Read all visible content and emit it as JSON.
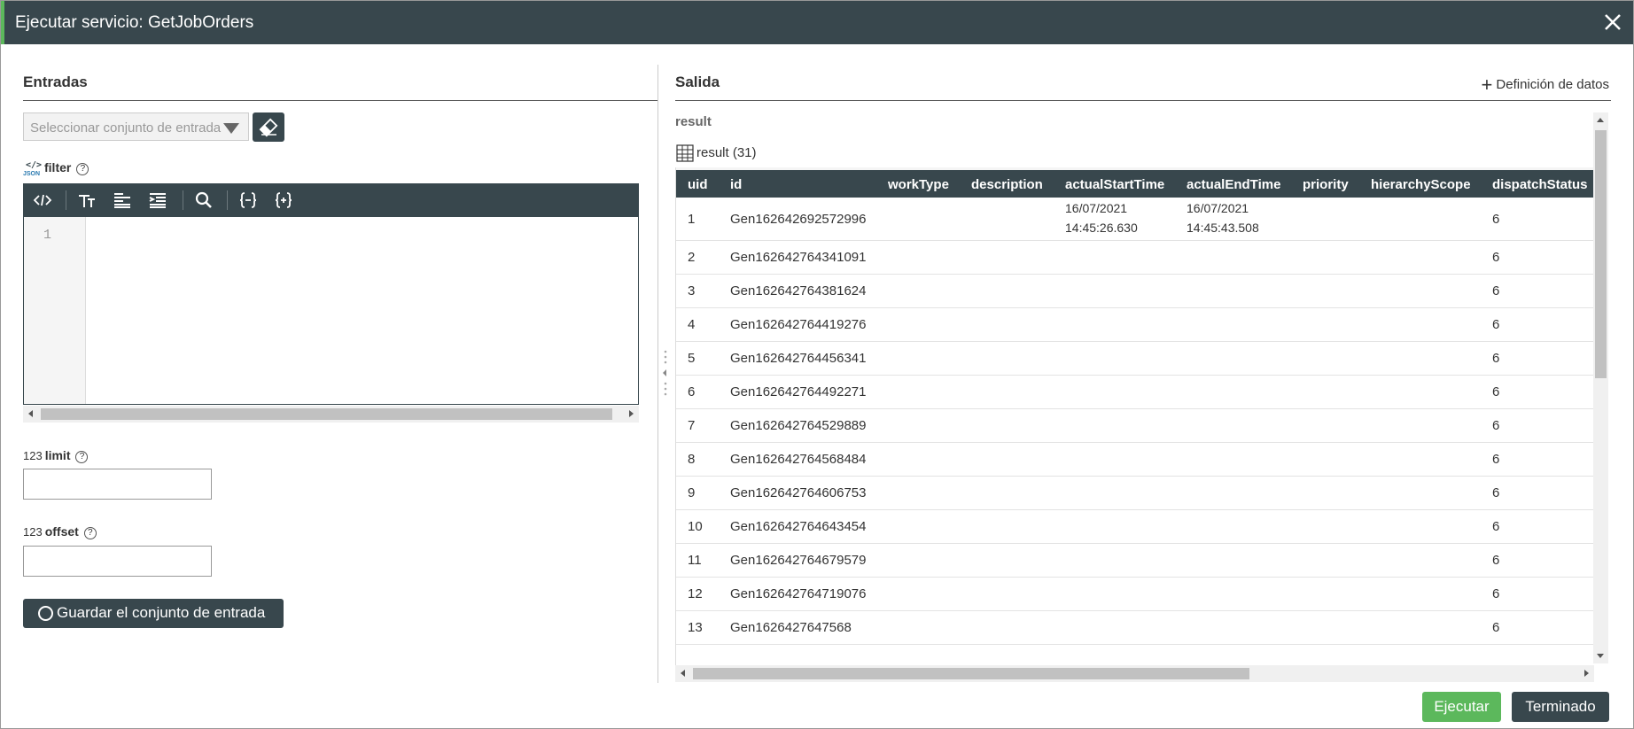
{
  "dialog": {
    "title": "Ejecutar servicio: GetJobOrders",
    "close_icon": "close-icon"
  },
  "inputs": {
    "heading": "Entradas",
    "input_set_placeholder": "Seleccionar conjunto de entrada",
    "clear_icon": "eraser-icon",
    "filter": {
      "type": "</>",
      "type_sub": "JSON",
      "label": "filter",
      "toolbar_icons": [
        "code-icon",
        "text-size-icon",
        "align-left-icon",
        "indent-icon",
        "search-icon",
        "braces-collapse-icon",
        "braces-expand-icon"
      ],
      "line_number": "1"
    },
    "limit": {
      "type": "123",
      "label": "limit",
      "value": ""
    },
    "offset": {
      "type": "123",
      "label": "offset",
      "value": ""
    },
    "save_label": "Guardar el conjunto de entrada"
  },
  "output": {
    "heading": "Salida",
    "data_definition": "Definición de datos",
    "result_label": "result",
    "result_count": "result (31)",
    "columns": [
      "uid",
      "id",
      "workType",
      "description",
      "actualStartTime",
      "actualEndTime",
      "priority",
      "hierarchyScope",
      "dispatchStatus"
    ],
    "rows": [
      {
        "uid": "1",
        "id": "Gen162642692572996",
        "start1": "16/07/2021",
        "start2": "14:45:26.630",
        "end1": "16/07/2021",
        "end2": "14:45:43.508",
        "dispatchStatus": "6"
      },
      {
        "uid": "2",
        "id": "Gen162642764341091",
        "dispatchStatus": "6"
      },
      {
        "uid": "3",
        "id": "Gen162642764381624",
        "dispatchStatus": "6"
      },
      {
        "uid": "4",
        "id": "Gen162642764419276",
        "dispatchStatus": "6"
      },
      {
        "uid": "5",
        "id": "Gen162642764456341",
        "dispatchStatus": "6"
      },
      {
        "uid": "6",
        "id": "Gen162642764492271",
        "dispatchStatus": "6"
      },
      {
        "uid": "7",
        "id": "Gen162642764529889",
        "dispatchStatus": "6"
      },
      {
        "uid": "8",
        "id": "Gen162642764568484",
        "dispatchStatus": "6"
      },
      {
        "uid": "9",
        "id": "Gen162642764606753",
        "dispatchStatus": "6"
      },
      {
        "uid": "10",
        "id": "Gen162642764643454",
        "dispatchStatus": "6"
      },
      {
        "uid": "11",
        "id": "Gen162642764679579",
        "dispatchStatus": "6"
      },
      {
        "uid": "12",
        "id": "Gen162642764719076",
        "dispatchStatus": "6"
      },
      {
        "uid": "13",
        "id": "Gen1626427647568",
        "dispatchStatus": "6"
      }
    ]
  },
  "footer": {
    "run_label": "Ejecutar",
    "done_label": "Terminado"
  },
  "colors": {
    "header_bg": "#38474d",
    "accent_green": "#5cb85c"
  }
}
